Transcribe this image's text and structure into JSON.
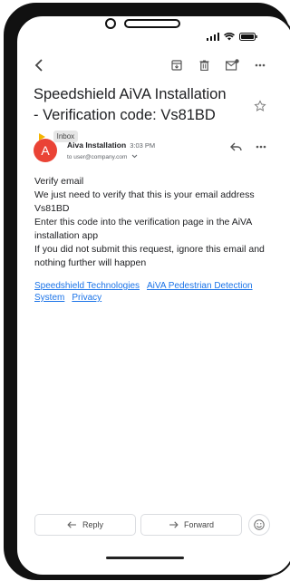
{
  "email": {
    "subject": "Speedshield AiVA Installation - Verification code: Vs81BD",
    "label_chip": "Inbox",
    "sender_initial": "A",
    "sender_name": "Aiva Installation",
    "time": "3:03 PM",
    "to": "to user@company.com",
    "body_lines": [
      "Verify email",
      "We just need to verify that this is your email address",
      "Vs81BD",
      "Enter this code into the verification page in the AiVA installation app",
      "If you did not submit this request, ignore this email and nothing further will happen"
    ],
    "links": [
      "Speedshield Technologies",
      "AiVA Pedestrian Detection System",
      "Privacy"
    ]
  },
  "actions": {
    "reply_label": "Reply",
    "forward_label": "Forward"
  },
  "colors": {
    "avatar": "#ea4335",
    "link": "#1a73e8",
    "importance": "#f4b400"
  },
  "icons": [
    "back-arrow-icon",
    "archive-icon",
    "delete-icon",
    "mark-unread-icon",
    "more-vert-icon",
    "star-icon",
    "reply-icon",
    "more-horiz-icon",
    "emoji-icon",
    "signal-icon",
    "wifi-icon",
    "battery-icon"
  ]
}
